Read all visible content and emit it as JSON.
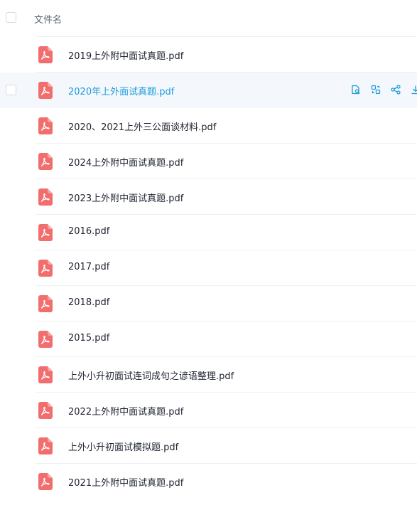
{
  "header": {
    "name_label": "文件名"
  },
  "files": [
    {
      "name": "2019上外附中面试真题.pdf"
    },
    {
      "name": "2020年上外面试真题.pdf"
    },
    {
      "name": "2020、2021上外三公面谈材料.pdf"
    },
    {
      "name": "2024上外附中面试真题.pdf"
    },
    {
      "name": "2023上外附中面试真题.pdf"
    },
    {
      "name": "2016.pdf"
    },
    {
      "name": "2017.pdf"
    },
    {
      "name": "2018.pdf"
    },
    {
      "name": "2015.pdf"
    },
    {
      "name": "上外小升初面试连词成句之谚语整理.pdf"
    },
    {
      "name": "2022上外附中面试真题.pdf"
    },
    {
      "name": "上外小升初面试模拟题.pdf"
    },
    {
      "name": "2021上外附中面试真题.pdf"
    }
  ],
  "hover_actions": [
    "preview-icon",
    "copy-icon",
    "share-icon",
    "download-icon"
  ],
  "colors": {
    "accent": "#1e9bd8",
    "pdf_icon": "#f26d6d",
    "hover_row_bg": "#f4f8fd"
  }
}
